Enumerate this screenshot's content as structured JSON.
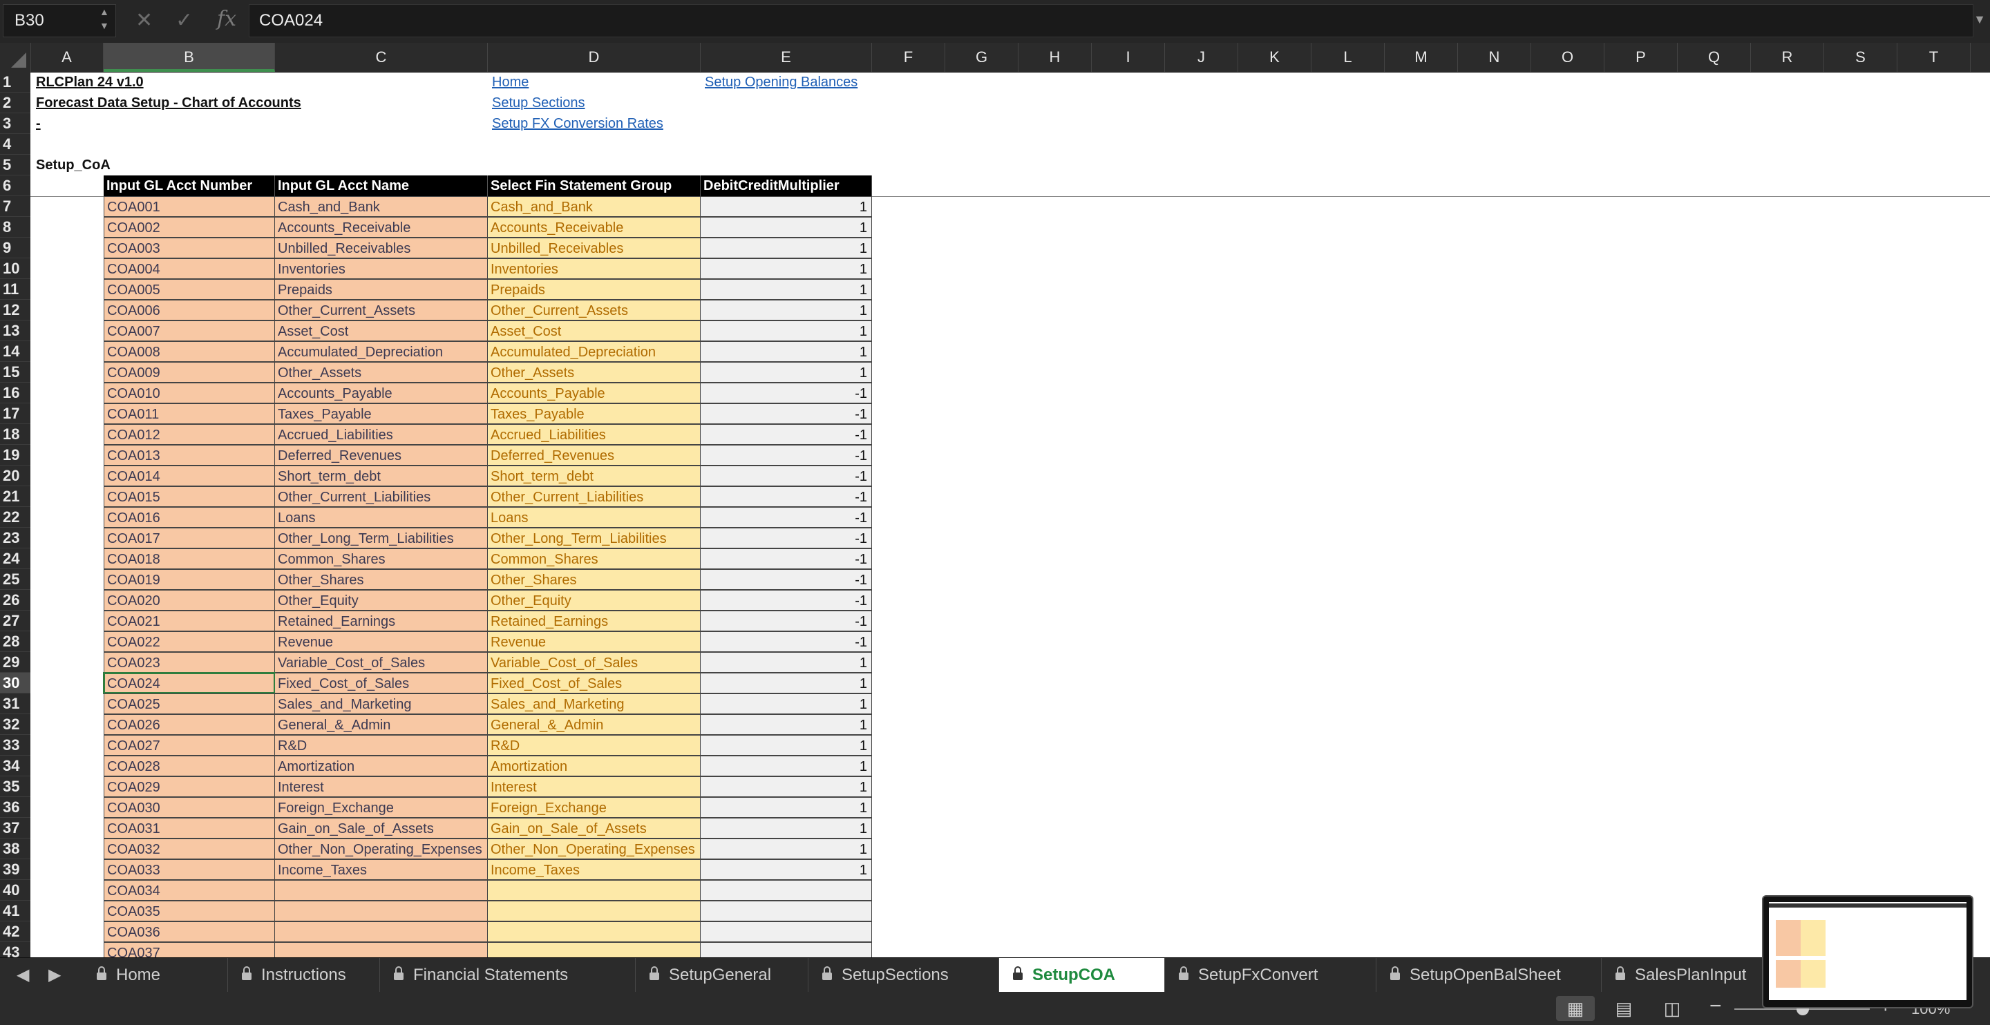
{
  "formula_bar": {
    "name_box": "B30",
    "cancel_icon": "✕",
    "enter_icon": "✓",
    "fx_label": "fx",
    "formula": "COA024"
  },
  "columns": [
    "A",
    "B",
    "C",
    "D",
    "E",
    "F",
    "G",
    "H",
    "I",
    "J",
    "K",
    "L",
    "M",
    "N",
    "O",
    "P",
    "Q",
    "R",
    "S",
    "T"
  ],
  "selected_column": "B",
  "selected_row": 30,
  "header_rows": [
    "1",
    "2",
    "3",
    "4",
    "5",
    "6"
  ],
  "titles": {
    "a1": "RLCPlan 24 v1.0",
    "a2": "Forecast Data Setup - Chart of Accounts",
    "a3": "-",
    "a5": "Setup_CoA"
  },
  "links": {
    "home": "Home",
    "setup_sections": "Setup Sections",
    "setup_fx": "Setup FX Conversion Rates",
    "setup_opening": "Setup Opening Balances"
  },
  "table_headers": [
    "Input GL Acct Number",
    "Input GL Acct Name",
    "Select Fin Statement Group",
    "DebitCreditMultiplier"
  ],
  "rows": [
    {
      "r": "7",
      "b": "COA001",
      "c": "Cash_and_Bank",
      "d": "Cash_and_Bank",
      "e": "1"
    },
    {
      "r": "8",
      "b": "COA002",
      "c": "Accounts_Receivable",
      "d": "Accounts_Receivable",
      "e": "1"
    },
    {
      "r": "9",
      "b": "COA003",
      "c": "Unbilled_Receivables",
      "d": "Unbilled_Receivables",
      "e": "1"
    },
    {
      "r": "10",
      "b": "COA004",
      "c": "Inventories",
      "d": "Inventories",
      "e": "1"
    },
    {
      "r": "11",
      "b": "COA005",
      "c": "Prepaids",
      "d": "Prepaids",
      "e": "1"
    },
    {
      "r": "12",
      "b": "COA006",
      "c": "Other_Current_Assets",
      "d": "Other_Current_Assets",
      "e": "1"
    },
    {
      "r": "13",
      "b": "COA007",
      "c": "Asset_Cost",
      "d": "Asset_Cost",
      "e": "1"
    },
    {
      "r": "14",
      "b": "COA008",
      "c": "Accumulated_Depreciation",
      "d": "Accumulated_Depreciation",
      "e": "1"
    },
    {
      "r": "15",
      "b": "COA009",
      "c": "Other_Assets",
      "d": "Other_Assets",
      "e": "1"
    },
    {
      "r": "16",
      "b": "COA010",
      "c": "Accounts_Payable",
      "d": "Accounts_Payable",
      "e": "-1"
    },
    {
      "r": "17",
      "b": "COA011",
      "c": "Taxes_Payable",
      "d": "Taxes_Payable",
      "e": "-1"
    },
    {
      "r": "18",
      "b": "COA012",
      "c": "Accrued_Liabilities",
      "d": "Accrued_Liabilities",
      "e": "-1"
    },
    {
      "r": "19",
      "b": "COA013",
      "c": "Deferred_Revenues",
      "d": "Deferred_Revenues",
      "e": "-1"
    },
    {
      "r": "20",
      "b": "COA014",
      "c": "Short_term_debt",
      "d": "Short_term_debt",
      "e": "-1"
    },
    {
      "r": "21",
      "b": "COA015",
      "c": "Other_Current_Liabilities",
      "d": "Other_Current_Liabilities",
      "e": "-1"
    },
    {
      "r": "22",
      "b": "COA016",
      "c": "Loans",
      "d": "Loans",
      "e": "-1"
    },
    {
      "r": "23",
      "b": "COA017",
      "c": "Other_Long_Term_Liabilities",
      "d": "Other_Long_Term_Liabilities",
      "e": "-1"
    },
    {
      "r": "24",
      "b": "COA018",
      "c": "Common_Shares",
      "d": "Common_Shares",
      "e": "-1"
    },
    {
      "r": "25",
      "b": "COA019",
      "c": "Other_Shares",
      "d": "Other_Shares",
      "e": "-1"
    },
    {
      "r": "26",
      "b": "COA020",
      "c": "Other_Equity",
      "d": "Other_Equity",
      "e": "-1"
    },
    {
      "r": "27",
      "b": "COA021",
      "c": "Retained_Earnings",
      "d": "Retained_Earnings",
      "e": "-1"
    },
    {
      "r": "28",
      "b": "COA022",
      "c": "Revenue",
      "d": "Revenue",
      "e": "-1"
    },
    {
      "r": "29",
      "b": "COA023",
      "c": "Variable_Cost_of_Sales",
      "d": "Variable_Cost_of_Sales",
      "e": "1"
    },
    {
      "r": "30",
      "b": "COA024",
      "c": "Fixed_Cost_of_Sales",
      "d": "Fixed_Cost_of_Sales",
      "e": "1"
    },
    {
      "r": "31",
      "b": "COA025",
      "c": "Sales_and_Marketing",
      "d": "Sales_and_Marketing",
      "e": "1"
    },
    {
      "r": "32",
      "b": "COA026",
      "c": "General_&_Admin",
      "d": "General_&_Admin",
      "e": "1"
    },
    {
      "r": "33",
      "b": "COA027",
      "c": "R&D",
      "d": "R&D",
      "e": "1"
    },
    {
      "r": "34",
      "b": "COA028",
      "c": "Amortization",
      "d": "Amortization",
      "e": "1"
    },
    {
      "r": "35",
      "b": "COA029",
      "c": "Interest",
      "d": "Interest",
      "e": "1"
    },
    {
      "r": "36",
      "b": "COA030",
      "c": "Foreign_Exchange",
      "d": "Foreign_Exchange",
      "e": "1"
    },
    {
      "r": "37",
      "b": "COA031",
      "c": "Gain_on_Sale_of_Assets",
      "d": "Gain_on_Sale_of_Assets",
      "e": "1"
    },
    {
      "r": "38",
      "b": "COA032",
      "c": "Other_Non_Operating_Expenses",
      "d": "Other_Non_Operating_Expenses",
      "e": "1"
    },
    {
      "r": "39",
      "b": "COA033",
      "c": "Income_Taxes",
      "d": "Income_Taxes",
      "e": "1"
    },
    {
      "r": "40",
      "b": "COA034",
      "c": "",
      "d": "",
      "e": ""
    },
    {
      "r": "41",
      "b": "COA035",
      "c": "",
      "d": "",
      "e": ""
    },
    {
      "r": "42",
      "b": "COA036",
      "c": "",
      "d": "",
      "e": ""
    },
    {
      "r": "43",
      "b": "COA037",
      "c": "",
      "d": "",
      "e": ""
    }
  ],
  "sheet_tabs": [
    {
      "label": "Home",
      "active": false
    },
    {
      "label": "Instructions",
      "active": false
    },
    {
      "label": "Financial Statements",
      "active": false
    },
    {
      "label": "SetupGeneral",
      "active": false
    },
    {
      "label": "SetupSections",
      "active": false
    },
    {
      "label": "SetupCOA",
      "active": true
    },
    {
      "label": "SetupFxConvert",
      "active": false
    },
    {
      "label": "SetupOpenBalSheet",
      "active": false
    },
    {
      "label": "SalesPlanInput",
      "active": false
    },
    {
      "label": "",
      "active": false
    }
  ],
  "status": {
    "zoom": "100%",
    "zoom_level_percent": 100
  },
  "colors": {
    "input_orange": "#f8c8a4",
    "select_yellow": "#fde9a8",
    "link_blue": "#1f5fb5",
    "active_tab_green": "#1e8a3e"
  }
}
